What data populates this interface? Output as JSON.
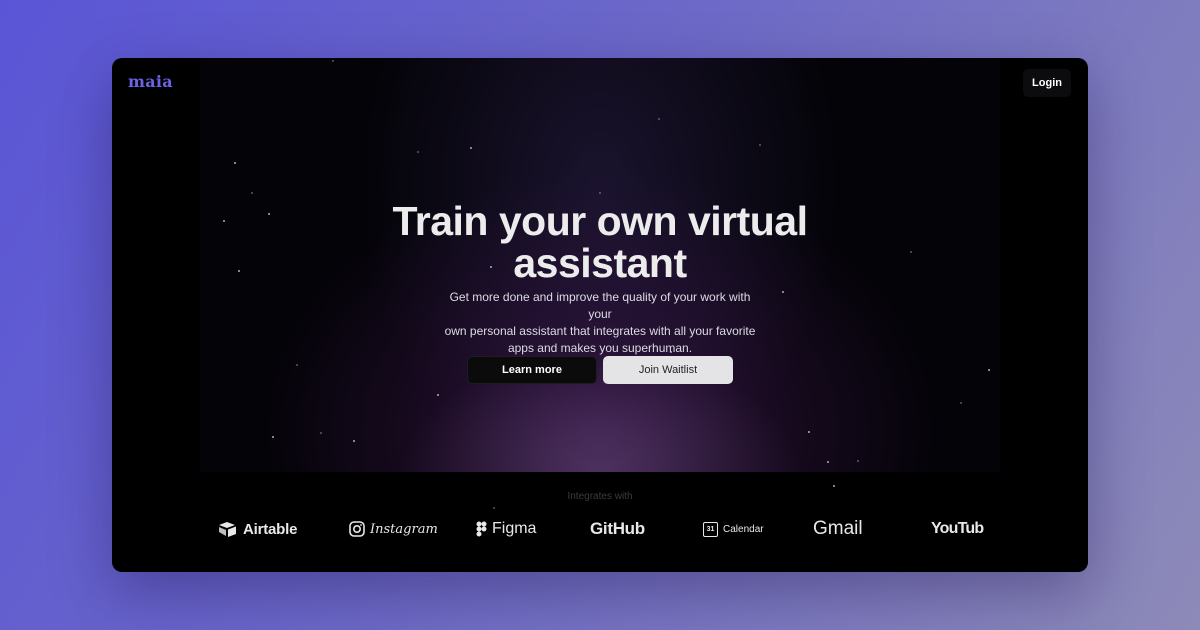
{
  "header": {
    "logo_text": "maia",
    "login_label": "Login"
  },
  "hero": {
    "title_line1": "Train your own virtual",
    "title_line2": "assistant",
    "subtitle_line1": "Get more done and improve the quality of your work with your",
    "subtitle_line2": "own personal assistant that integrates with all your favorite",
    "subtitle_line3": "apps and makes you superhuman.",
    "learn_more_label": "Learn more",
    "join_waitlist_label": "Join Waitlist"
  },
  "integrations": {
    "label": "Integrates with",
    "brands": {
      "airtable": "Airtable",
      "instagram": "Instagram",
      "figma": "Figma",
      "github": "GitHub",
      "calendar": "Calendar",
      "calendar_day": "31",
      "gmail": "Gmail",
      "youtube": "YouTube"
    }
  },
  "colors": {
    "logo": "#6b63e6",
    "background_gradient_start": "#5a55d6",
    "background_gradient_end": "#8d8ab8"
  }
}
